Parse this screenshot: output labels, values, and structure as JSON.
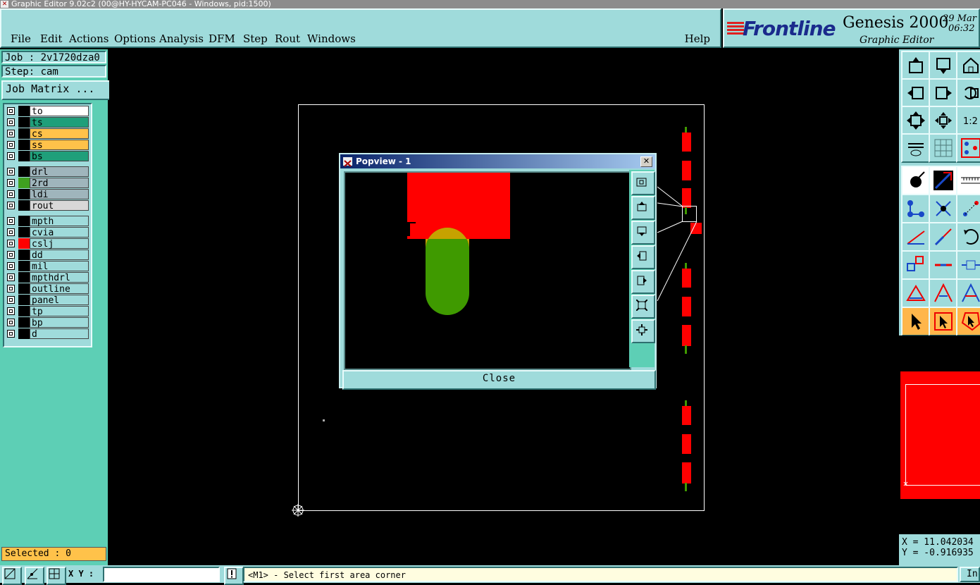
{
  "window": {
    "title": "Graphic Editor 9.02c2 (00@HY-HYCAM-PC046 - Windows, pid:1500)"
  },
  "menu": {
    "items": [
      "File",
      "Edit",
      "Actions",
      "Options",
      "Analysis",
      "DFM",
      "Step",
      "Rout",
      "Windows"
    ],
    "help": "Help"
  },
  "brand": {
    "logo": "Frontline",
    "product": "Genesis 2000",
    "subtitle": "Graphic Editor",
    "date": "29 Mar",
    "time": "06:32"
  },
  "job": {
    "job_label": "Job : 2v1720dza0",
    "step_label": "Step: cam",
    "matrix_button": "Job Matrix ..."
  },
  "layers": [
    {
      "name": "to",
      "color": "#ffffff",
      "swatch": "#000000"
    },
    {
      "name": "ts",
      "color": "#1f9f7a",
      "swatch": "#000000"
    },
    {
      "name": "cs",
      "color": "#ffc24a",
      "swatch": "#000000"
    },
    {
      "name": "ss",
      "color": "#ffc24a",
      "swatch": "#000000"
    },
    {
      "name": "bs",
      "color": "#1f9f7a",
      "swatch": "#000000"
    },
    {
      "name": "drl",
      "color": "#9fb5bc",
      "swatch": "#000000"
    },
    {
      "name": "2rd",
      "color": "#9fb5bc",
      "swatch": "#3fa020"
    },
    {
      "name": "ldi",
      "color": "#9fb5bc",
      "swatch": "#000000"
    },
    {
      "name": "rout",
      "color": "#d8d8d8",
      "swatch": "#000000"
    },
    {
      "name": "mpth",
      "color": "#9fdbdb",
      "swatch": "#000000"
    },
    {
      "name": "cvia",
      "color": "#9fdbdb",
      "swatch": "#000000"
    },
    {
      "name": "cslj",
      "color": "#9fdbdb",
      "swatch": "#ff0000"
    },
    {
      "name": "dd",
      "color": "#9fdbdb",
      "swatch": "#000000"
    },
    {
      "name": "mil",
      "color": "#9fdbdb",
      "swatch": "#000000"
    },
    {
      "name": "mpthdrl",
      "color": "#9fdbdb",
      "swatch": "#000000"
    },
    {
      "name": "outline",
      "color": "#9fdbdb",
      "swatch": "#000000"
    },
    {
      "name": "panel",
      "color": "#9fdbdb",
      "swatch": "#000000"
    },
    {
      "name": "tp",
      "color": "#9fdbdb",
      "swatch": "#000000"
    },
    {
      "name": "bp",
      "color": "#9fdbdb",
      "swatch": "#000000"
    },
    {
      "name": "d",
      "color": "#9fdbdb",
      "swatch": "#000000"
    }
  ],
  "selected": "Selected : 0",
  "popview": {
    "title": "Popview - 1",
    "close_label": "Close"
  },
  "coords": {
    "x": "X = 11.042034",
    "y": "Y = -0.916935"
  },
  "status": {
    "xy_label": "X Y :",
    "message": "<M1> - Select first area corner",
    "right_button": "Inc"
  },
  "colors": {
    "panel": "#9fdbdb",
    "accent_green": "#5dcfb5",
    "pad_red": "#ff0000",
    "drill_green": "#3f9a00"
  }
}
